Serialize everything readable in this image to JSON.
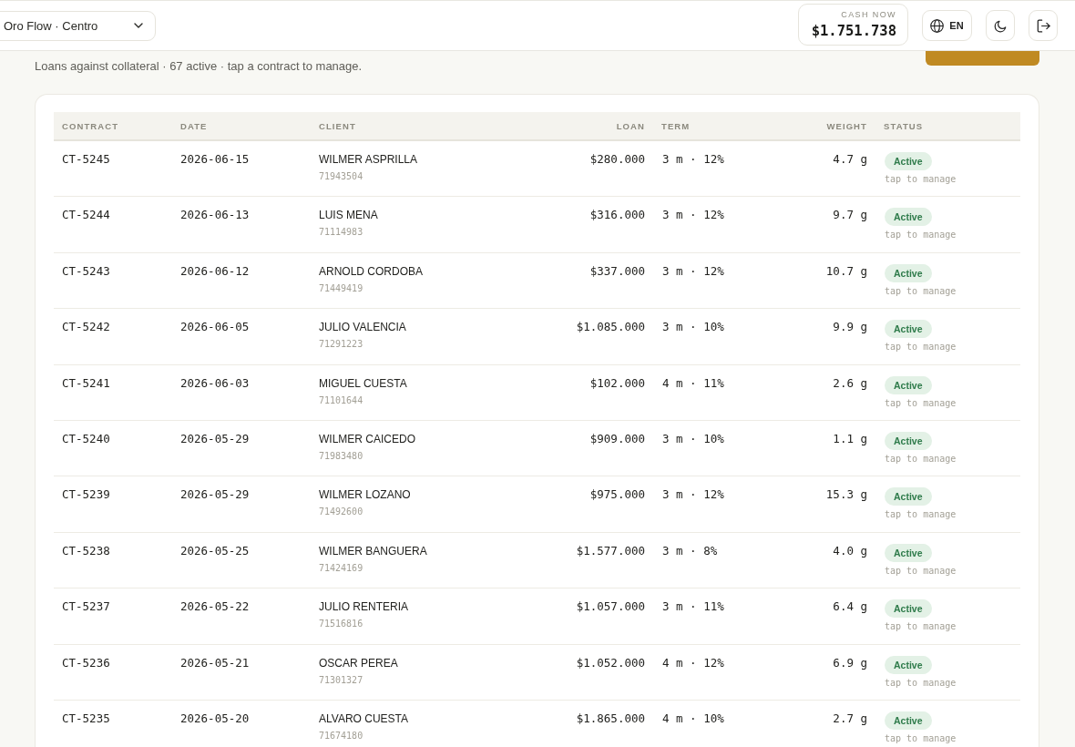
{
  "header": {
    "location_selector": {
      "value": "Oro Flow · Centro"
    },
    "cash": {
      "label": "CASH NOW",
      "amount": "$1.751.738"
    },
    "language_button": {
      "label": "EN"
    }
  },
  "page": {
    "subtitle": "Loans against collateral · 67 active · tap a contract to manage."
  },
  "table": {
    "columns": [
      "CONTRACT",
      "DATE",
      "CLIENT",
      "LOAN",
      "TERM",
      "WEIGHT",
      "STATUS"
    ],
    "rows": [
      {
        "contract": "CT-5245",
        "date": "2026-06-15",
        "client": {
          "name": "WILMER ASPRILLA",
          "id": "71943504"
        },
        "loan": "$280.000",
        "term": "3 m · 12%",
        "weight": "4.7 g",
        "status": {
          "label": "Active",
          "kind": "active"
        },
        "hint": "tap to manage"
      },
      {
        "contract": "CT-5244",
        "date": "2026-06-13",
        "client": {
          "name": "LUIS MENA",
          "id": "71114983"
        },
        "loan": "$316.000",
        "term": "3 m · 12%",
        "weight": "9.7 g",
        "status": {
          "label": "Active",
          "kind": "active"
        },
        "hint": "tap to manage"
      },
      {
        "contract": "CT-5243",
        "date": "2026-06-12",
        "client": {
          "name": "ARNOLD CORDOBA",
          "id": "71449419"
        },
        "loan": "$337.000",
        "term": "3 m · 12%",
        "weight": "10.7 g",
        "status": {
          "label": "Active",
          "kind": "active"
        },
        "hint": "tap to manage"
      },
      {
        "contract": "CT-5242",
        "date": "2026-06-05",
        "client": {
          "name": "JULIO VALENCIA",
          "id": "71291223"
        },
        "loan": "$1.085.000",
        "term": "3 m · 10%",
        "weight": "9.9 g",
        "status": {
          "label": "Active",
          "kind": "active"
        },
        "hint": "tap to manage"
      },
      {
        "contract": "CT-5241",
        "date": "2026-06-03",
        "client": {
          "name": "MIGUEL CUESTA",
          "id": "71101644"
        },
        "loan": "$102.000",
        "term": "4 m · 11%",
        "weight": "2.6 g",
        "status": {
          "label": "Active",
          "kind": "active"
        },
        "hint": "tap to manage"
      },
      {
        "contract": "CT-5240",
        "date": "2026-05-29",
        "client": {
          "name": "WILMER CAICEDO",
          "id": "71983480"
        },
        "loan": "$909.000",
        "term": "3 m · 10%",
        "weight": "1.1 g",
        "status": {
          "label": "Active",
          "kind": "active"
        },
        "hint": "tap to manage"
      },
      {
        "contract": "CT-5239",
        "date": "2026-05-29",
        "client": {
          "name": "WILMER LOZANO",
          "id": "71492600"
        },
        "loan": "$975.000",
        "term": "3 m · 12%",
        "weight": "15.3 g",
        "status": {
          "label": "Active",
          "kind": "active"
        },
        "hint": "tap to manage"
      },
      {
        "contract": "CT-5238",
        "date": "2026-05-25",
        "client": {
          "name": "WILMER BANGUERA",
          "id": "71424169"
        },
        "loan": "$1.577.000",
        "term": "3 m · 8%",
        "weight": "4.0 g",
        "status": {
          "label": "Active",
          "kind": "active"
        },
        "hint": "tap to manage"
      },
      {
        "contract": "CT-5237",
        "date": "2026-05-22",
        "client": {
          "name": "JULIO RENTERIA",
          "id": "71516816"
        },
        "loan": "$1.057.000",
        "term": "3 m · 11%",
        "weight": "6.4 g",
        "status": {
          "label": "Active",
          "kind": "active"
        },
        "hint": "tap to manage"
      },
      {
        "contract": "CT-5236",
        "date": "2026-05-21",
        "client": {
          "name": "OSCAR PEREA",
          "id": "71301327"
        },
        "loan": "$1.052.000",
        "term": "4 m · 12%",
        "weight": "6.9 g",
        "status": {
          "label": "Active",
          "kind": "active"
        },
        "hint": "tap to manage"
      },
      {
        "contract": "CT-5235",
        "date": "2026-05-20",
        "client": {
          "name": "ALVARO CUESTA",
          "id": "71674180"
        },
        "loan": "$1.865.000",
        "term": "4 m · 10%",
        "weight": "2.7 g",
        "status": {
          "label": "Active",
          "kind": "active"
        },
        "hint": "tap to manage"
      }
    ]
  }
}
